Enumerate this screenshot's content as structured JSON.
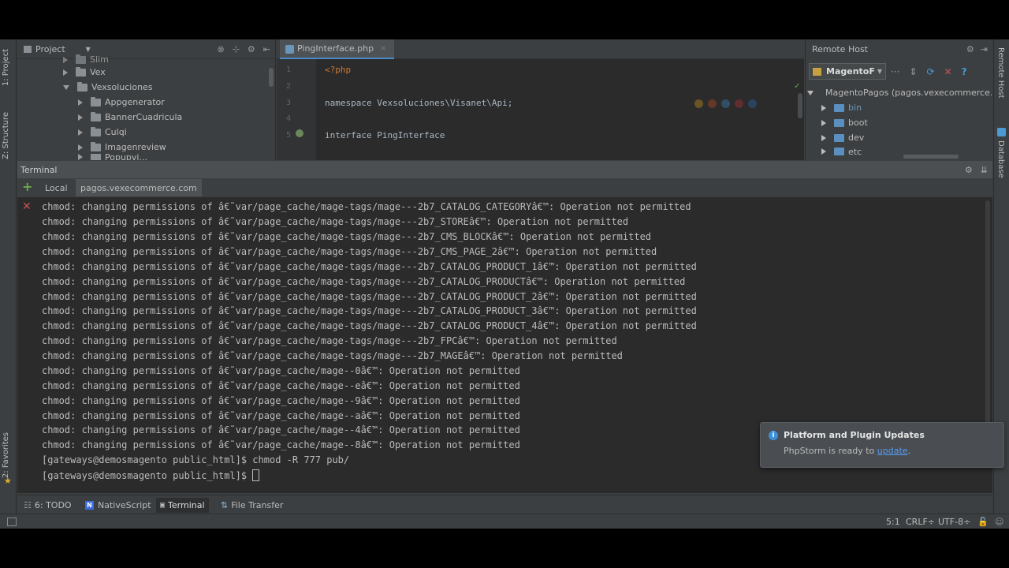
{
  "left_stripe": {
    "project_tab": "1: Project",
    "structure_tab": "Z: Structure",
    "favorites_tab": "2: Favorites"
  },
  "right_stripe": {
    "remote_host_tab": "Remote Host",
    "database_tab": "Database"
  },
  "project_panel": {
    "title": "Project",
    "items": [
      {
        "label": "Slim",
        "expanded": false
      },
      {
        "label": "Vex",
        "expanded": false
      },
      {
        "label": "Vexsoluciones",
        "expanded": true
      },
      {
        "label": "Appgenerator",
        "expanded": false
      },
      {
        "label": "BannerCuadricula",
        "expanded": false
      },
      {
        "label": "Culqi",
        "expanded": false
      },
      {
        "label": "Imagenreview",
        "expanded": false
      },
      {
        "label": "Popupvi...",
        "expanded": false
      }
    ]
  },
  "editor": {
    "tab_label": "PingInterface.php",
    "lines": [
      {
        "num": "1",
        "text": "<?php"
      },
      {
        "num": "2",
        "text": ""
      },
      {
        "num": "3",
        "text": "namespace Vexsoluciones\\Visanet\\Api;"
      },
      {
        "num": "4",
        "text": ""
      },
      {
        "num": "5",
        "text": "interface PingInterface"
      }
    ]
  },
  "remote_host": {
    "title": "Remote Host",
    "server_select": "MagentoF",
    "root_label": "MagentoPagos (pagos.vexecommerce.com)",
    "items": [
      "bin",
      "boot",
      "dev",
      "etc"
    ]
  },
  "terminal": {
    "title": "Terminal",
    "tabs": [
      "Local",
      "pagos.vexecommerce.com"
    ],
    "lines": [
      "chmod: changing permissions of â€˜var/page_cache/mage-tags/mage---2b7_CATALOG_CATEGORYâ€™: Operation not permitted",
      "chmod: changing permissions of â€˜var/page_cache/mage-tags/mage---2b7_STOREâ€™: Operation not permitted",
      "chmod: changing permissions of â€˜var/page_cache/mage-tags/mage---2b7_CMS_BLOCKâ€™: Operation not permitted",
      "chmod: changing permissions of â€˜var/page_cache/mage-tags/mage---2b7_CMS_PAGE_2â€™: Operation not permitted",
      "chmod: changing permissions of â€˜var/page_cache/mage-tags/mage---2b7_CATALOG_PRODUCT_1â€™: Operation not permitted",
      "chmod: changing permissions of â€˜var/page_cache/mage-tags/mage---2b7_CATALOG_PRODUCTâ€™: Operation not permitted",
      "chmod: changing permissions of â€˜var/page_cache/mage-tags/mage---2b7_CATALOG_PRODUCT_2â€™: Operation not permitted",
      "chmod: changing permissions of â€˜var/page_cache/mage-tags/mage---2b7_CATALOG_PRODUCT_3â€™: Operation not permitted",
      "chmod: changing permissions of â€˜var/page_cache/mage-tags/mage---2b7_CATALOG_PRODUCT_4â€™: Operation not permitted",
      "chmod: changing permissions of â€˜var/page_cache/mage-tags/mage---2b7_FPCâ€™: Operation not permitted",
      "chmod: changing permissions of â€˜var/page_cache/mage-tags/mage---2b7_MAGEâ€™: Operation not permitted",
      "chmod: changing permissions of â€˜var/page_cache/mage--0â€™: Operation not permitted",
      "chmod: changing permissions of â€˜var/page_cache/mage--eâ€™: Operation not permitted",
      "chmod: changing permissions of â€˜var/page_cache/mage--9â€™: Operation not permitted",
      "chmod: changing permissions of â€˜var/page_cache/mage--aâ€™: Operation not permitted",
      "chmod: changing permissions of â€˜var/page_cache/mage--4â€™: Operation not permitted",
      "chmod: changing permissions of â€˜var/page_cache/mage--8â€™: Operation not permitted",
      "[gateways@demosmagento public_html]$ chmod -R 777 pub/"
    ],
    "prompt": "[gateways@demosmagento public_html]$ "
  },
  "bottom_tools": {
    "todo": "6: TODO",
    "nativescript": "NativeScript",
    "terminal": "Terminal",
    "file_transfer": "File Transfer"
  },
  "status_bar": {
    "position": "5:1",
    "line_sep": "CRLF÷",
    "encoding": "UTF-8÷"
  },
  "notification": {
    "title": "Platform and Plugin Updates",
    "body_prefix": "PhpStorm is ready to ",
    "link": "update",
    "body_suffix": "."
  },
  "colors": {
    "accent": "#4a88c7",
    "error": "#c75450",
    "add": "#6aa84f"
  }
}
